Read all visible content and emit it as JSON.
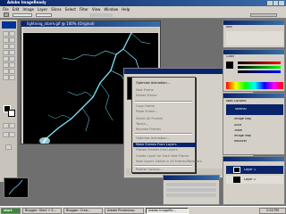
{
  "app": {
    "title": "Adobe ImageReady"
  },
  "menubar": [
    "File",
    "Edit",
    "Image",
    "Layer",
    "Slices",
    "Select",
    "Filter",
    "View",
    "Window",
    "Help"
  ],
  "document": {
    "title": "lightning_storm.gif @ 100% (Original)"
  },
  "context_menu": {
    "items": [
      {
        "label": "Optimize Animation...",
        "enabled": true
      },
      {
        "label": "New Frame",
        "enabled": false
      },
      {
        "label": "Delete Frame",
        "enabled": false
      },
      {
        "label": "Copy Frame",
        "enabled": false
      },
      {
        "label": "Paste Frame...",
        "enabled": false
      },
      {
        "label": "Select All Frames",
        "enabled": false
      },
      {
        "label": "Tween...",
        "enabled": false
      },
      {
        "label": "Reverse Frames",
        "enabled": false
      },
      {
        "label": "Optimize Animation...",
        "enabled": false
      },
      {
        "label": "Make Frames From Layers",
        "enabled": true,
        "highlighted": true
      },
      {
        "label": "Flatten Frames Into Layers",
        "enabled": false
      },
      {
        "label": "Create Layer for Each New Frame",
        "enabled": false
      },
      {
        "label": "New Layers Visible in All Frames/Rollovers",
        "enabled": false
      },
      {
        "label": "Palette Options...",
        "enabled": false
      }
    ]
  },
  "panels": {
    "info_tab": "Info",
    "color_tab": "Color",
    "styles_tab": "Web Content",
    "layer_name": "Normal",
    "layer_sub": "Image Map",
    "layers": [
      "Layer 1",
      "Layer 2"
    ],
    "actions": [
      "Slice",
      "Table",
      "Image Map",
      "Rollover"
    ]
  },
  "taskbar": {
    "start": "start",
    "tasks": [
      "Blogger: Start + E...",
      "Blogger: Crea...",
      "Adobe Photoshop",
      "Adobe ImageRe..."
    ],
    "clock": "2:50 PM"
  },
  "colors": {
    "title_bar": "#0a246a",
    "menu_highlight": "#0a246a",
    "canvas": "#000000",
    "lightning": "#7fe8ff"
  }
}
